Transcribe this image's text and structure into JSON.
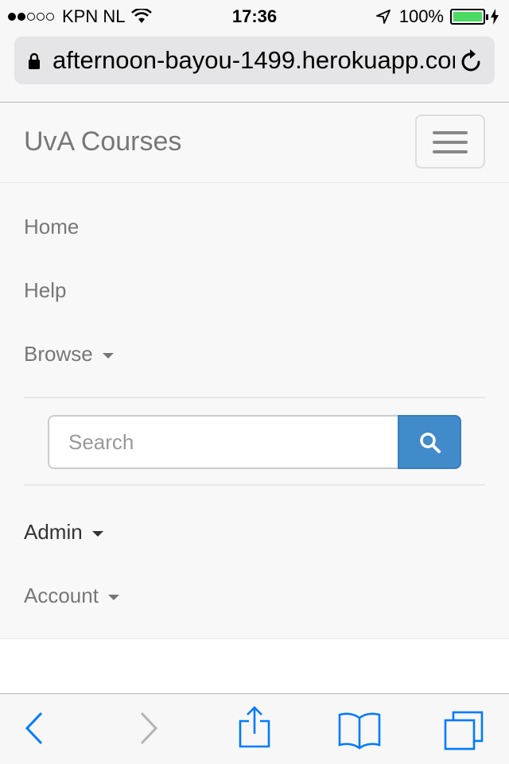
{
  "status_bar": {
    "signal_bars_filled": 2,
    "signal_bars_total": 5,
    "carrier": "KPN NL",
    "wifi_icon": "wifi-icon",
    "time": "17:36",
    "location_icon": "location-arrow-icon",
    "battery_percent": "100%",
    "battery_level": 1.0,
    "charging_icon": "lightning-bolt-icon"
  },
  "browser": {
    "url": "afternoon-bayou-1499.herokuapp.com",
    "lock_icon": "lock-icon",
    "reload_icon": "reload-icon"
  },
  "navbar": {
    "brand": "UvA Courses",
    "toggle_icon": "hamburger-icon",
    "items": [
      {
        "label": "Home"
      },
      {
        "label": "Help"
      },
      {
        "label": "Browse"
      }
    ],
    "search": {
      "placeholder": "Search",
      "button_icon": "search-icon"
    },
    "items_bottom": [
      {
        "label": "Admin"
      },
      {
        "label": "Account"
      }
    ]
  },
  "toolbar": {
    "icons": [
      "back-icon",
      "forward-icon",
      "share-icon",
      "bookmarks-icon",
      "tabs-icon"
    ]
  },
  "colors": {
    "accent": "#428bca",
    "ios_blue": "#007aff",
    "battery_green": "#4cd964",
    "navbar_bg": "#f8f8f8",
    "nav_text": "#777777"
  }
}
